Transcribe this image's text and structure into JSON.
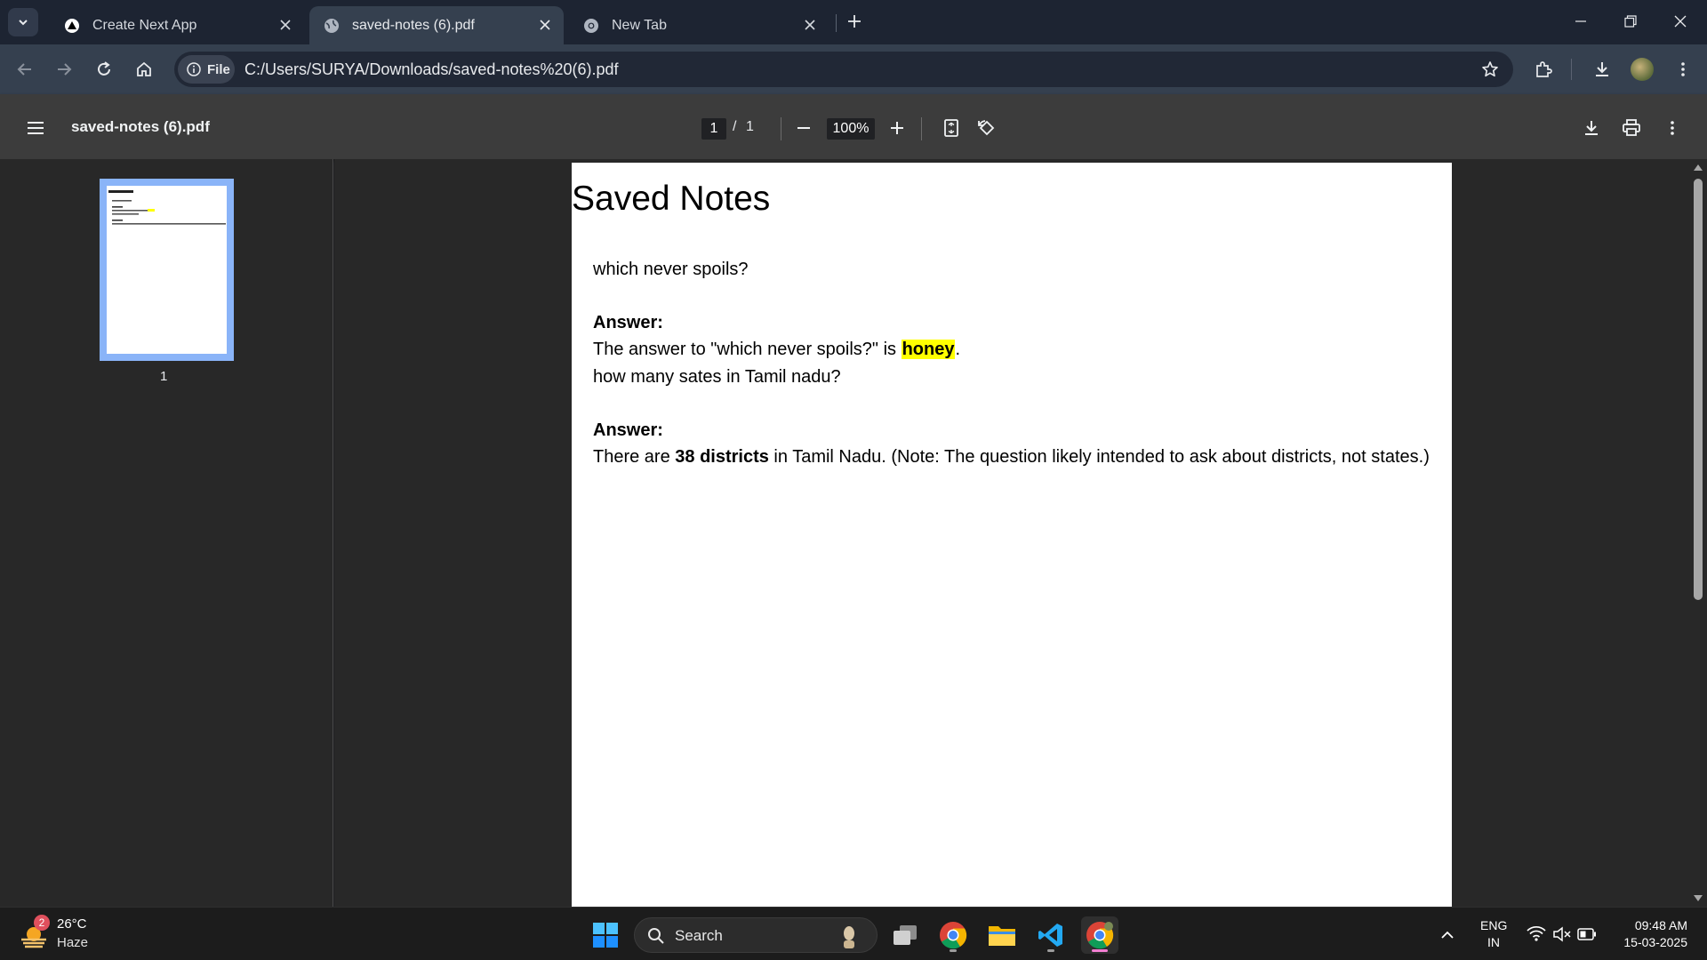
{
  "browser": {
    "tabs": [
      {
        "title": "Create Next App",
        "active": false
      },
      {
        "title": "saved-notes (6).pdf",
        "active": true
      },
      {
        "title": "New Tab",
        "active": false
      }
    ],
    "site_chip": "File",
    "url": "C:/Users/SURYA/Downloads/saved-notes%20(6).pdf"
  },
  "pdf_toolbar": {
    "filename": "saved-notes (6).pdf",
    "current_page": "1",
    "page_separator": "/",
    "total_pages": "1",
    "zoom": "100%"
  },
  "sidebar": {
    "thumbnail_label": "1"
  },
  "document": {
    "title": "Saved Notes",
    "q1": "which never spoils?",
    "a1_label": "Answer:",
    "a1_pre": "The answer to \"which never spoils?\" is ",
    "a1_bold": "honey",
    "a1_post": ".",
    "q2": "how many sates in Tamil nadu?",
    "a2_label": "Answer:",
    "a2_pre": "There are ",
    "a2_bold": "38 districts",
    "a2_post": " in Tamil Nadu. (Note: The question likely intended to ask about districts, not states.)"
  },
  "taskbar": {
    "weather_badge": "2",
    "temperature": "26°C",
    "condition": "Haze",
    "search_label": "Search",
    "lang_top": "ENG",
    "lang_bottom": "IN",
    "time": "09:48 AM",
    "date": "15-03-2025"
  },
  "colors": {
    "highlight": "#ffff00",
    "thumbnail_border": "#8ab4f8",
    "tabstrip_bg": "#1d2432",
    "toolbar_bg": "#35404f"
  }
}
